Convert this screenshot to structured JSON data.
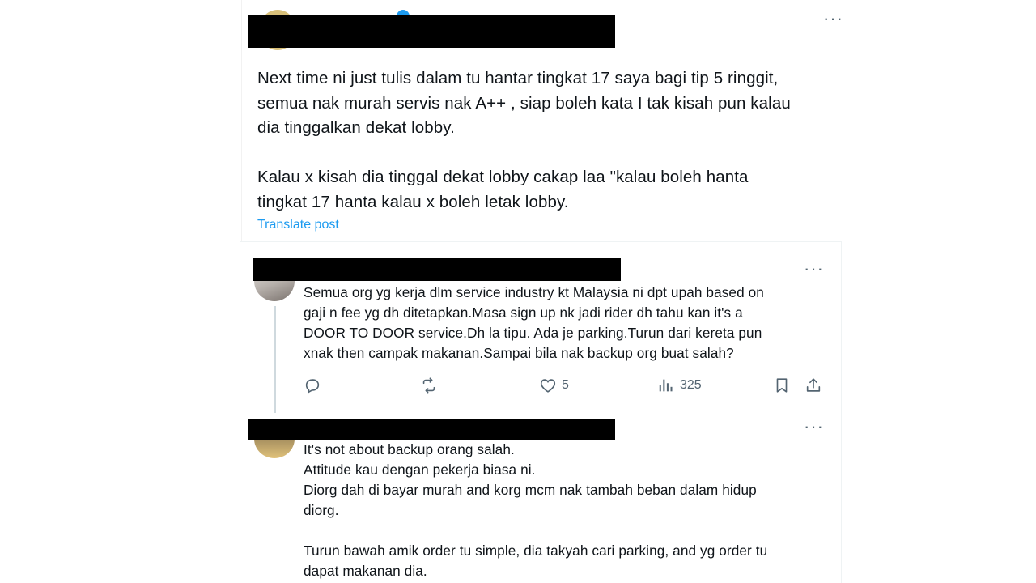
{
  "post": {
    "paragraph1": "Next time ni just tulis dalam tu hantar tingkat 17 saya bagi tip 5 ringgit,\nsemua nak murah servis nak A++ , siap boleh kata I tak kisah pun kalau\ndia tinggalkan dekat lobby.",
    "paragraph2": "Kalau x kisah dia tinggal dekat lobby cakap laa \"kalau boleh hanta\ntingkat 17 hanta kalau x boleh letak lobby.",
    "translate_label": "Translate post",
    "more_label": "···"
  },
  "reply1": {
    "text": "Semua org yg kerja dlm service industry kt Malaysia ni dpt upah based on\ngaji n fee yg dh ditetapkan.Masa sign up nk jadi rider dh tahu kan it's a\nDOOR TO DOOR service.Dh la tipu. Ada je parking.Turun dari kereta pun\nxnak then campak makanan.Sampai bila nak backup org buat salah?",
    "more_label": "···",
    "actions": {
      "likes": "5",
      "views": "325"
    }
  },
  "reply2": {
    "text": "It's not about backup orang salah.\nAttitude kau dengan pekerja biasa ni.\nDiorg dah di bayar murah and korg mcm nak tambah beban dalam hidup\ndiorg.\n\nTurun bawah amik order tu simple, dia takyah cari parking, and yg order tu\ndapat makanan dia.",
    "more_label": "···"
  },
  "icons": {
    "reply": "reply-icon",
    "retweet": "retweet-icon",
    "like": "heart-icon",
    "views": "views-icon",
    "bookmark": "bookmark-icon",
    "share": "share-icon",
    "more": "more-icon"
  },
  "colors": {
    "text": "#0f1419",
    "secondary": "#536471",
    "link": "#1d9bf0",
    "redaction": "#000000"
  }
}
